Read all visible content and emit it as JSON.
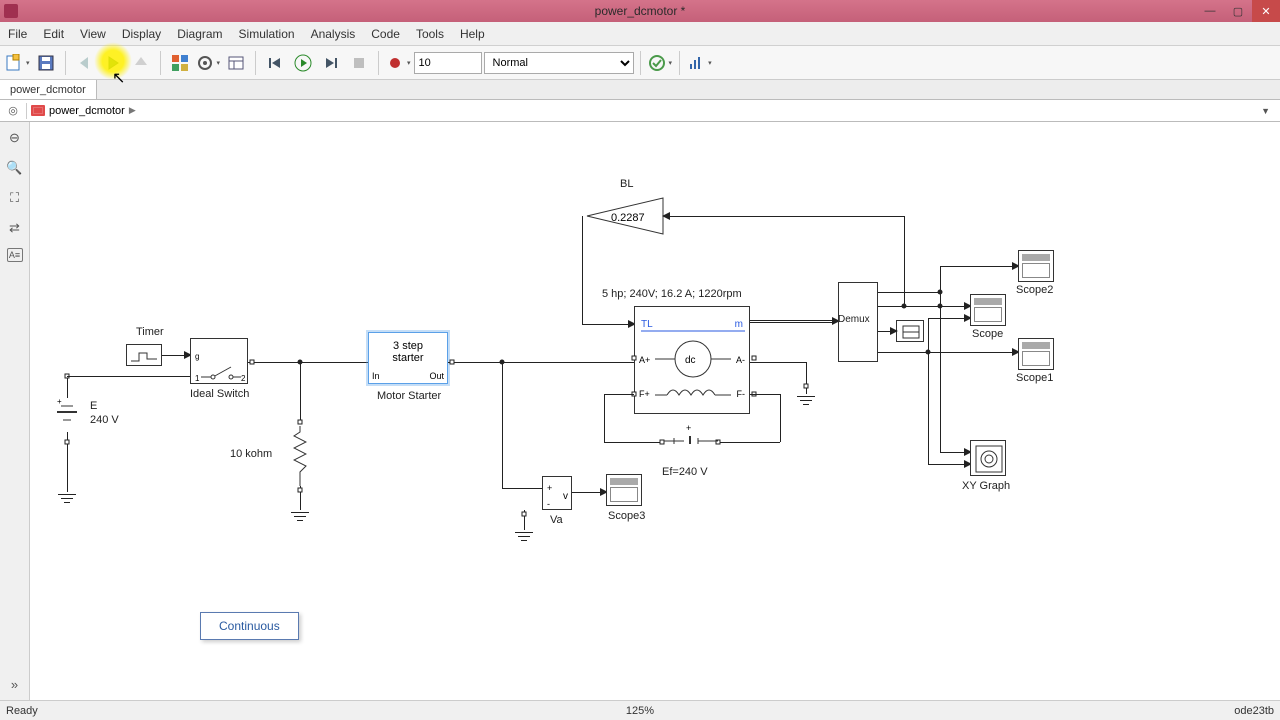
{
  "window": {
    "title": "power_dcmotor *"
  },
  "menu": {
    "items": [
      "File",
      "Edit",
      "View",
      "Display",
      "Diagram",
      "Simulation",
      "Analysis",
      "Code",
      "Tools",
      "Help"
    ]
  },
  "toolbar": {
    "stop_time": "10",
    "mode": "Normal"
  },
  "tabs": {
    "active": "power_dcmotor"
  },
  "breadcrumb": {
    "path": "power_dcmotor"
  },
  "canvas": {
    "timer_label": "Timer",
    "ideal_switch_label": "Ideal Switch",
    "source_name": "E",
    "source_value": "240 V",
    "resistor_label": "10 kohm",
    "starter_line1": "3 step",
    "starter_line2": "starter",
    "starter_in": "In",
    "starter_out": "Out",
    "starter_label": "Motor Starter",
    "gain_label": "BL",
    "gain_value": "0.2287",
    "machine_spec": "5 hp;  240V;  16.2 A;  1220rpm",
    "tl_port": "TL",
    "m_port": "m",
    "a_plus": "A+",
    "a_minus": "A-",
    "f_plus": "F+",
    "f_minus": "F-",
    "dc_label": "dc",
    "ef_label": "Ef=240 V",
    "va_label": "Va",
    "demux_label": "Demux",
    "scope_label": "Scope",
    "scope1_label": "Scope1",
    "scope2_label": "Scope2",
    "scope3_label": "Scope3",
    "xygraph_label": "XY Graph",
    "powergui": "Continuous"
  },
  "status": {
    "ready": "Ready",
    "zoom": "125%",
    "solver": "ode23tb"
  }
}
